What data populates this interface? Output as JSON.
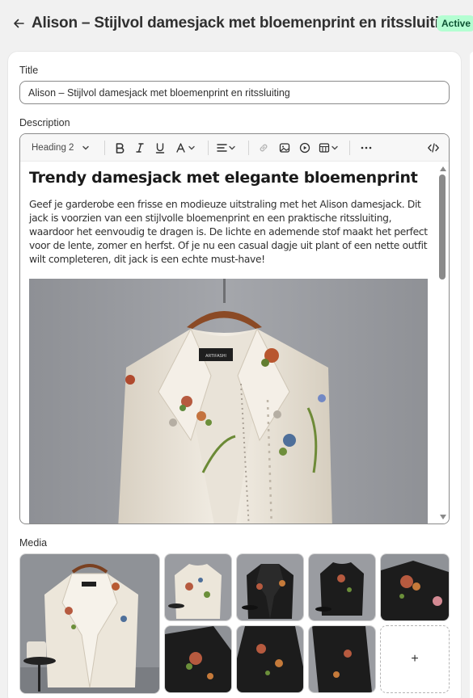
{
  "header": {
    "back_icon": "arrow-left-icon",
    "title": "Alison – Stijlvol damesjack met bloemenprint en ritssluiting",
    "status": "Active"
  },
  "title_field": {
    "label": "Title",
    "value": "Alison – Stijlvol damesjack met bloemenprint en ritssluiting"
  },
  "description": {
    "label": "Description",
    "toolbar": {
      "heading_select": "Heading 2",
      "icons": [
        "bold-icon",
        "italic-icon",
        "underline-icon",
        "text-color-icon",
        "align-icon",
        "link-icon",
        "image-icon",
        "video-icon",
        "table-icon",
        "more-icon",
        "code-icon"
      ]
    },
    "heading": "Trendy damesjack met elegante bloemenprint",
    "paragraph": "Geef je garderobe een frisse en modieuze uitstraling met het Alison damesjack. Dit jack is voorzien van een stijlvolle bloemenprint en een praktische ritssluiting, waardoor het eenvoudig te dragen is. De lichte en ademende stof maakt het perfect voor de lente, zomer en herfst. Of je nu een casual dagje uit plant of een nette outfit wilt completeren, dit jack is een echte must-have!",
    "image_label": "ARTIFASHI"
  },
  "media": {
    "label": "Media",
    "add_label": "+",
    "tiles": [
      {
        "name": "media-main-white-jacket",
        "variant": "white"
      },
      {
        "name": "media-white-jacket-back",
        "variant": "white"
      },
      {
        "name": "media-black-jacket-front",
        "variant": "black"
      },
      {
        "name": "media-black-jacket-open",
        "variant": "black"
      },
      {
        "name": "media-black-jacket-detail",
        "variant": "black"
      },
      {
        "name": "media-black-sleeve-detail",
        "variant": "black"
      },
      {
        "name": "media-black-jacket-closeup",
        "variant": "black"
      },
      {
        "name": "media-black-jacket-side",
        "variant": "black"
      }
    ]
  },
  "colors": {
    "badge_bg": "#b4fed2",
    "badge_text": "#0c5132",
    "white_jacket": "#efe9de",
    "black_jacket": "#1c1c1c",
    "backdrop": "#9a9ca1"
  }
}
